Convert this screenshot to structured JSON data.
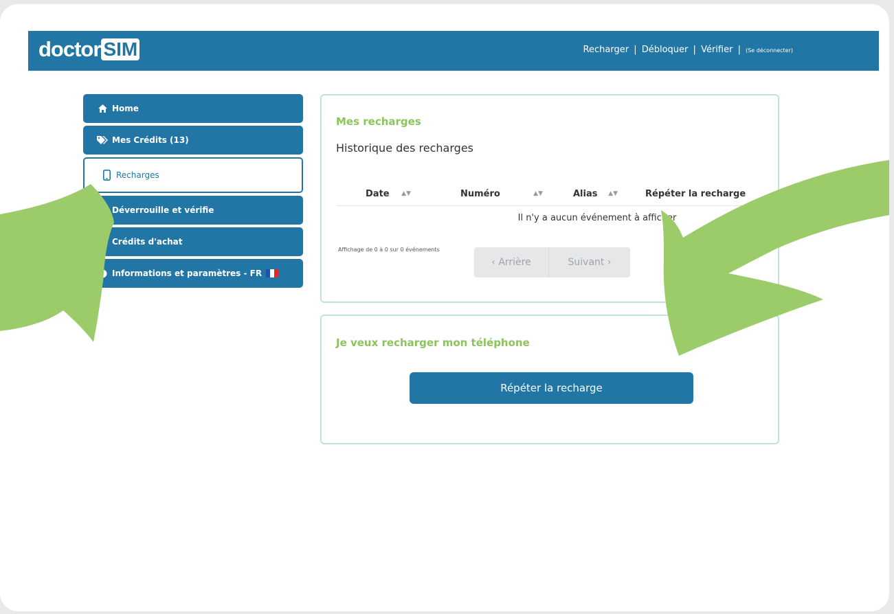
{
  "header": {
    "logo_text": "doctor",
    "logo_box_text": "SIM",
    "nav": {
      "recharger": "Recharger",
      "debloquer": "Débloquer",
      "verifier": "Vérifier",
      "separator": "|",
      "logout": "(Se déconnecter)"
    }
  },
  "sidebar": {
    "items": [
      {
        "label": "Home",
        "icon": "home-icon"
      },
      {
        "label": "Mes Crédits (13)",
        "icon": "tags-icon"
      },
      {
        "label": "Recharges",
        "icon": "mobile-icon"
      },
      {
        "label": "Déverrouille et vérifie",
        "icon": "unlock-icon"
      },
      {
        "label": "Crédits d'achat",
        "icon": "cart-icon"
      },
      {
        "label": "Informations et paramètres - FR",
        "icon": "info-icon"
      }
    ]
  },
  "recharges_panel": {
    "title": "Mes recharges",
    "subtitle": "Historique des recharges",
    "table": {
      "columns": [
        "Date",
        "Numéro",
        "Alias",
        "Répéter la recharge"
      ],
      "empty_message": "Il n'y a aucun événement à afficher"
    },
    "showing": "Affichage de 0 à 0 sur 0 événements",
    "pager": {
      "prev": "‹ Arrière",
      "next": "Suivant ›"
    }
  },
  "recharge_phone_panel": {
    "title": "Je veux recharger mon téléphone",
    "button": "Répéter la recharge"
  },
  "colors": {
    "brand_blue": "#2176a5",
    "accent_green": "#8cc45c",
    "arrow_green": "#9ccc6a"
  }
}
